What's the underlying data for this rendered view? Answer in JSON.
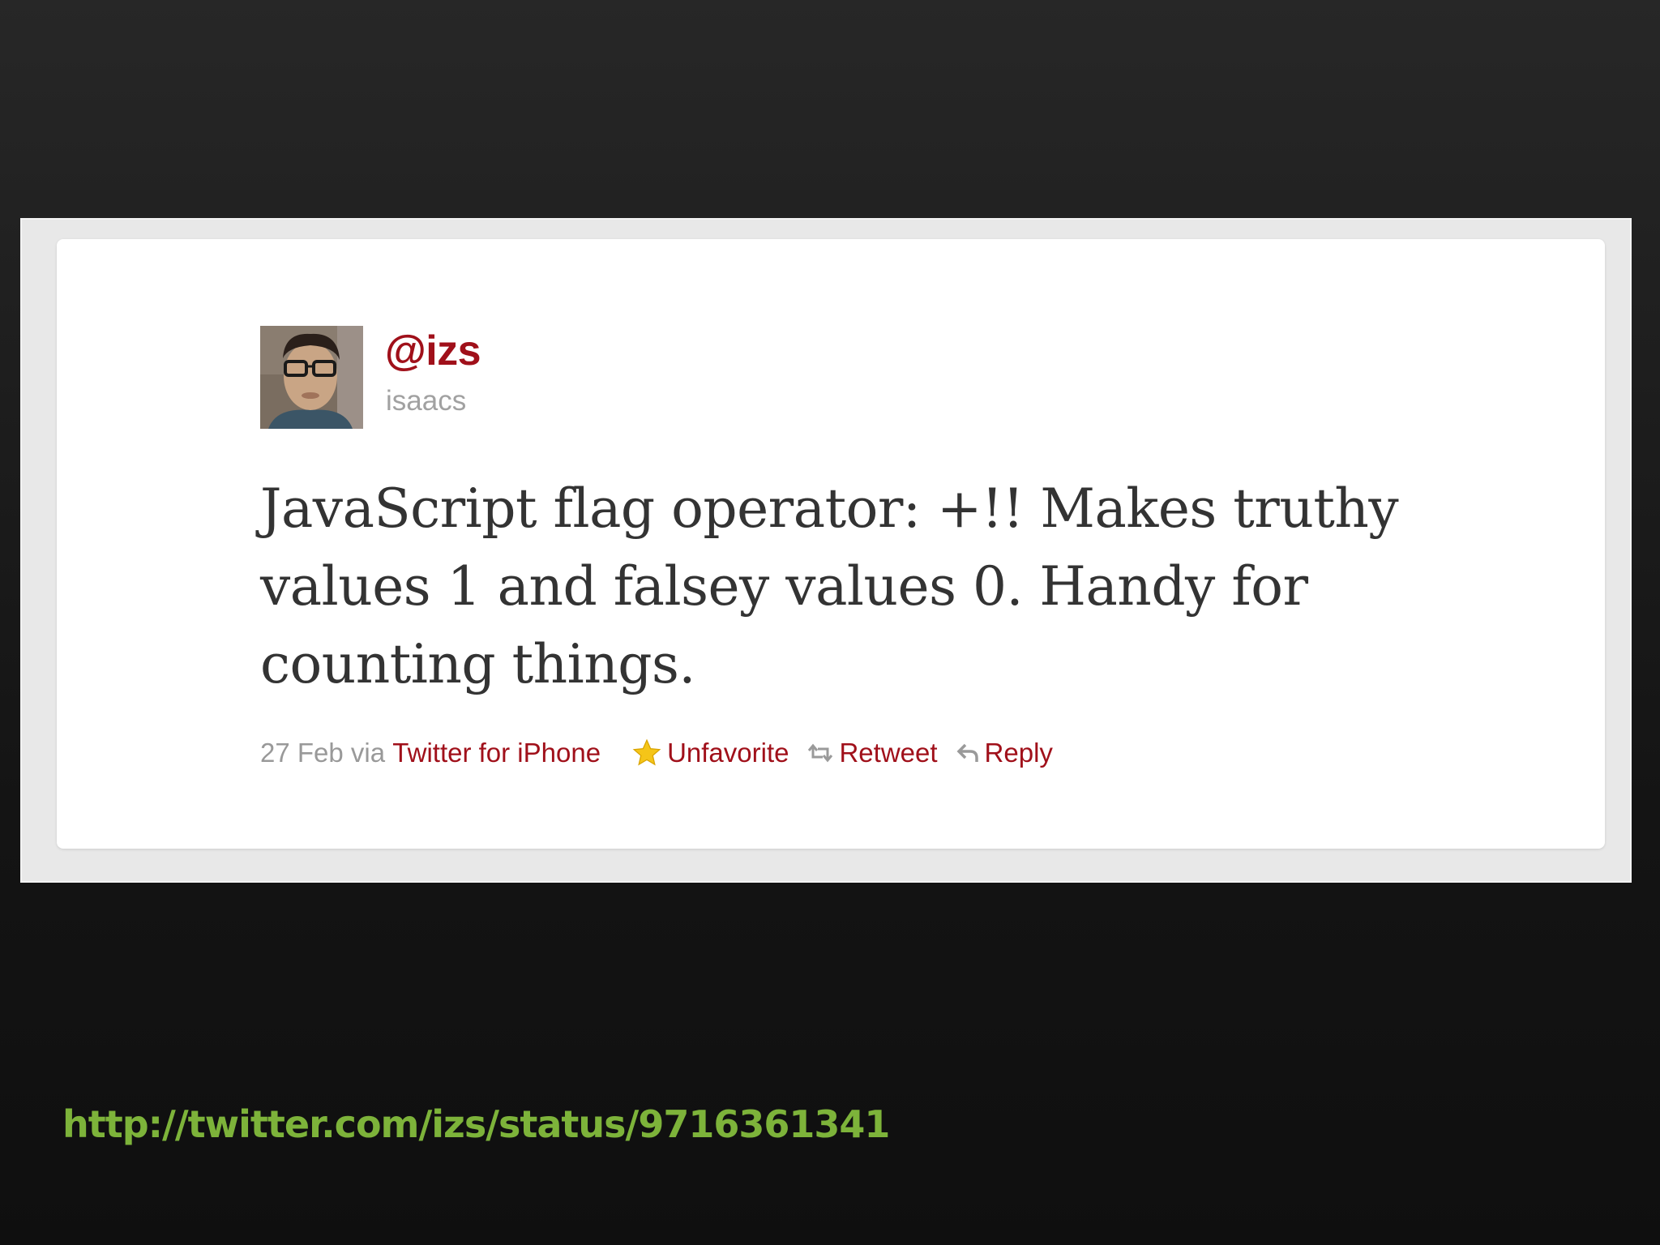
{
  "tweet": {
    "screen_name": "@izs",
    "full_name": "isaacs",
    "text": "JavaScript flag operator: +!! Makes truthy values 1 and falsey values 0. Handy for counting things.",
    "date": "27 Feb",
    "via_label": "via",
    "source": "Twitter for iPhone",
    "actions": {
      "unfavorite": "Unfavorite",
      "retweet": "Retweet",
      "reply": "Reply"
    },
    "icons": {
      "favorite": "star-icon",
      "retweet": "retweet-icon",
      "reply": "reply-icon"
    }
  },
  "slide": {
    "url": "http://twitter.com/izs/status/9716361341"
  },
  "colors": {
    "link_red": "#a0101a",
    "meta_gray": "#999999",
    "url_green": "#7db33a",
    "star_gold": "#f5c518"
  }
}
